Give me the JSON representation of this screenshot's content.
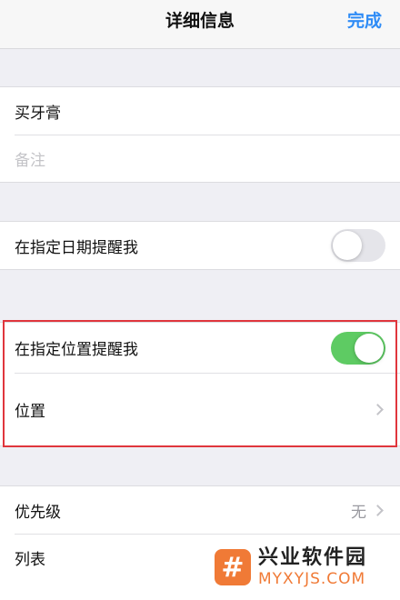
{
  "navbar": {
    "title": "详细信息",
    "done_label": "完成"
  },
  "task": {
    "title": "买牙膏",
    "notes_placeholder": "备注"
  },
  "date_reminder": {
    "label": "在指定日期提醒我",
    "enabled": false
  },
  "location_reminder": {
    "label": "在指定位置提醒我",
    "enabled": true,
    "location_label": "位置"
  },
  "details": {
    "priority_label": "优先级",
    "priority_value": "无",
    "list_label": "列表"
  },
  "watermark": {
    "icon_glyph": "#",
    "name": "兴业软件园",
    "url": "MYXYJS.COM"
  },
  "colors": {
    "accent": "#2f8cf6",
    "toggle_on": "#5ecb63",
    "highlight": "#e0363d",
    "watermark": "#f07a36"
  }
}
